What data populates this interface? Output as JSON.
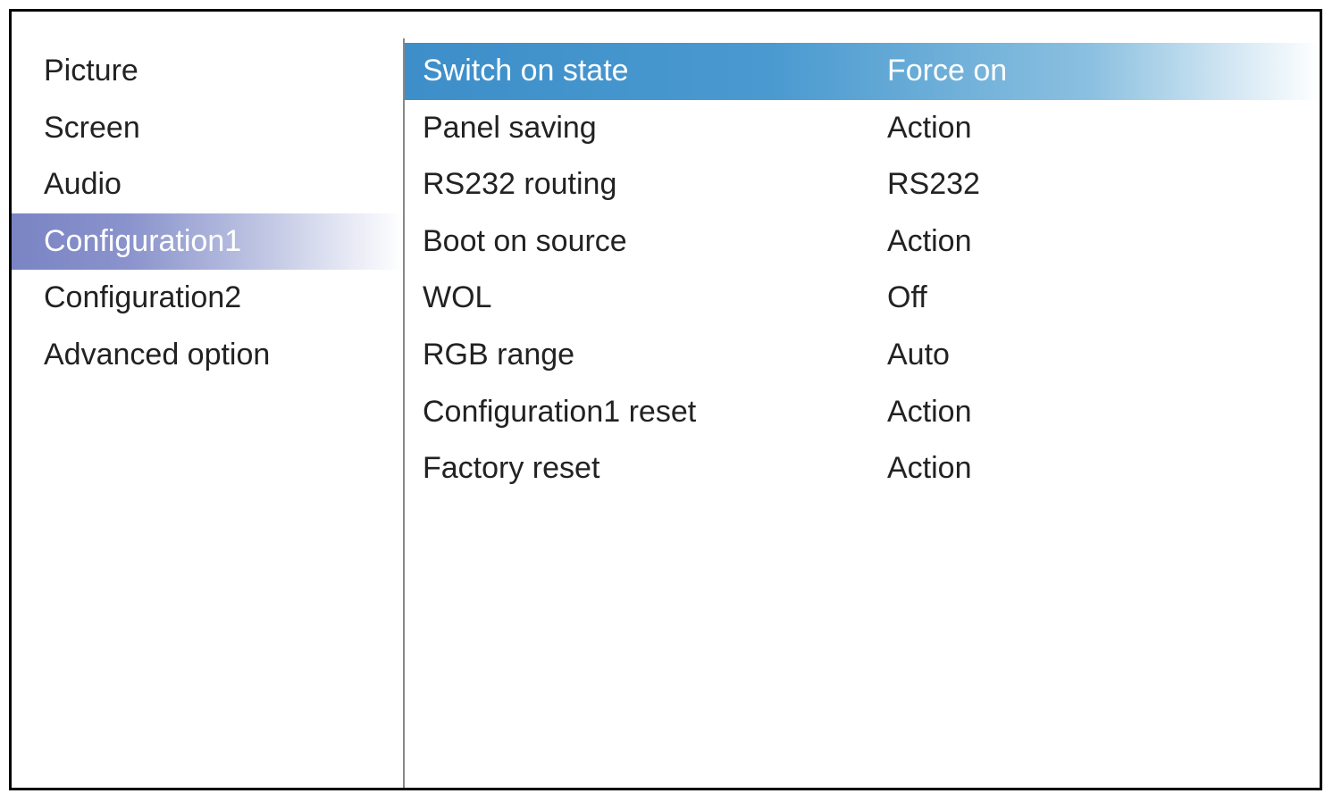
{
  "sidebar": {
    "items": [
      {
        "label": "Picture",
        "selected": false
      },
      {
        "label": "Screen",
        "selected": false
      },
      {
        "label": "Audio",
        "selected": false
      },
      {
        "label": "Configuration1",
        "selected": true
      },
      {
        "label": "Configuration2",
        "selected": false
      },
      {
        "label": "Advanced option",
        "selected": false
      }
    ]
  },
  "settings": {
    "items": [
      {
        "label": "Switch on state",
        "value": "Force on",
        "selected": true
      },
      {
        "label": "Panel saving",
        "value": "Action",
        "selected": false
      },
      {
        "label": "RS232 routing",
        "value": "RS232",
        "selected": false
      },
      {
        "label": "Boot on source",
        "value": "Action",
        "selected": false
      },
      {
        "label": "WOL",
        "value": "Off",
        "selected": false
      },
      {
        "label": "RGB range",
        "value": "Auto",
        "selected": false
      },
      {
        "label": "Configuration1 reset",
        "value": "Action",
        "selected": false
      },
      {
        "label": "Factory reset",
        "value": "Action",
        "selected": false
      }
    ]
  }
}
